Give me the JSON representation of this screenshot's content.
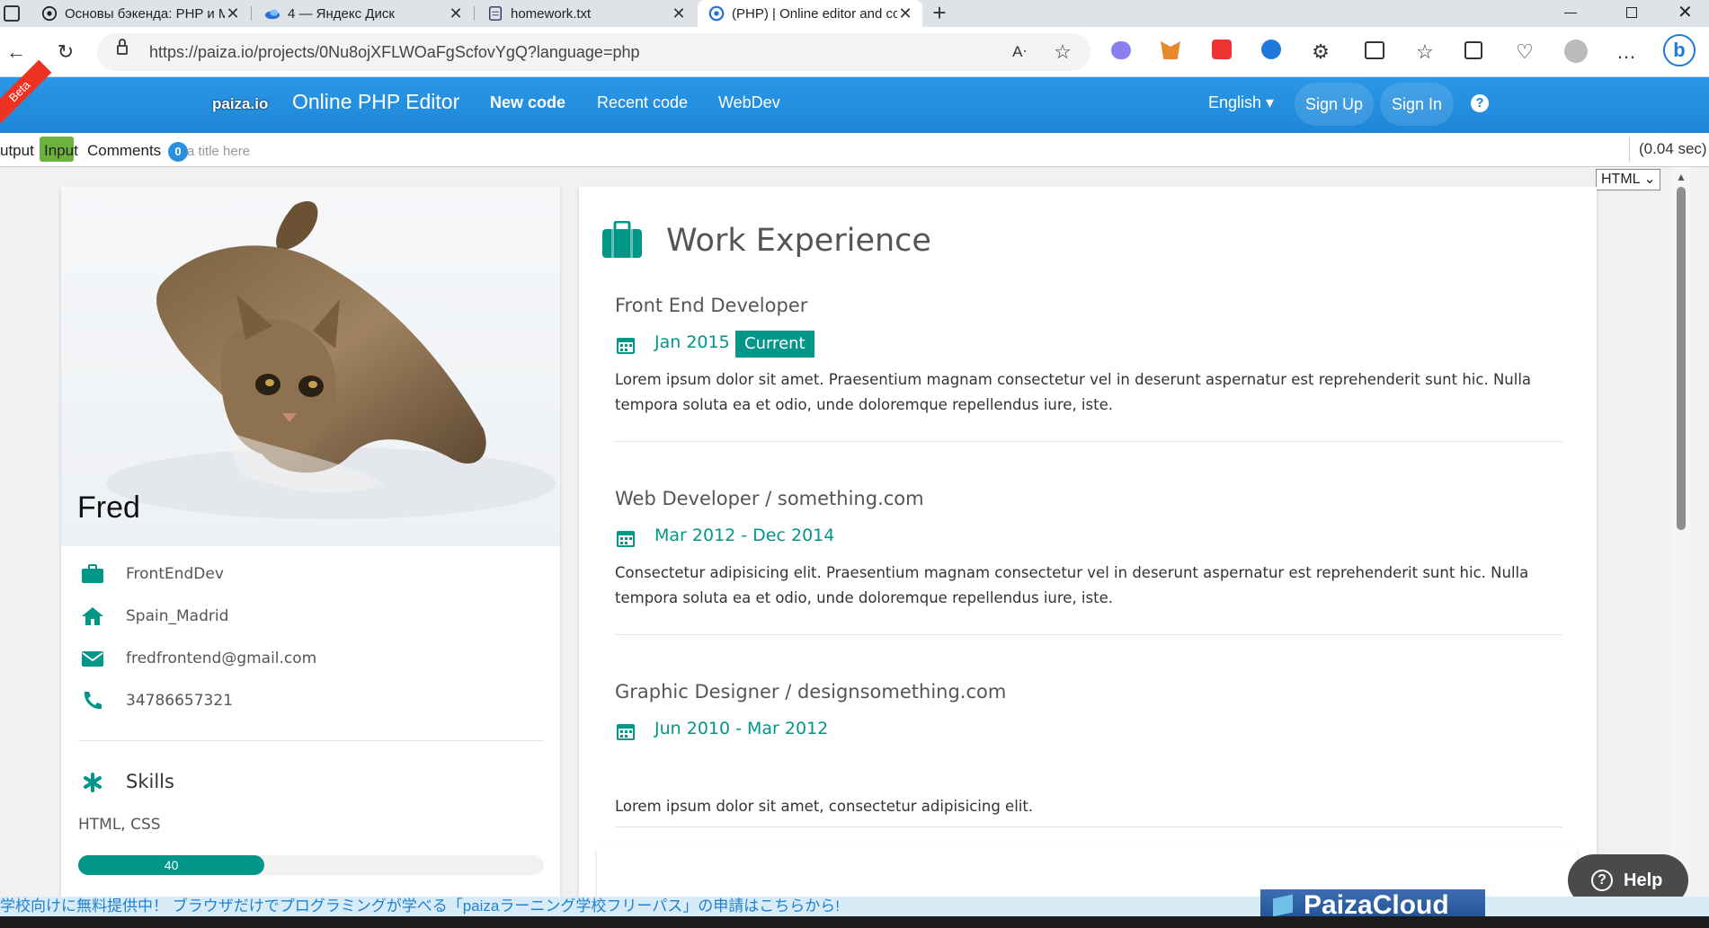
{
  "browser": {
    "tabs": [
      {
        "label": "Основы бэкенда: PHP и MySQL",
        "icon": "openai-icon"
      },
      {
        "label": "4 — Яндекс Диск",
        "icon": "yandex-disk-icon"
      },
      {
        "label": "homework.txt",
        "icon": "document-icon"
      },
      {
        "label": "(PHP) | Online editor and compiler",
        "icon": "paiza-icon"
      }
    ],
    "url": "https://paiza.io/projects/0Nu8ojXFLWOaFgScfovYgQ?language=php"
  },
  "paiza": {
    "ribbon": "Beta",
    "logo": "paiza.io",
    "editor_title": "Online PHP Editor",
    "nav": {
      "new_code": "New code",
      "recent_code": "Recent code",
      "webdev": "WebDev"
    },
    "language": "English",
    "sign_up": "Sign Up",
    "sign_in": "Sign In",
    "tabs": {
      "output": "utput",
      "input": "Input",
      "comments": "Comments",
      "comments_count": "0"
    },
    "title_placeholder": "Enter a title here",
    "exec_time": "(0.04 sec)",
    "view_select": "HTML"
  },
  "profile": {
    "name": "Fred",
    "job": "FrontEndDev",
    "location": "Spain_Madrid",
    "email": "fredfrontend@gmail.com",
    "phone": "34786657321",
    "skills_heading": "Skills",
    "skill_label": "HTML, CSS",
    "skill_value": "40",
    "skill_percent": 40
  },
  "work": {
    "heading": "Work Experience",
    "jobs": [
      {
        "title": "Front End Developer",
        "dates": "Jan 2015 - ",
        "badge": "Current",
        "desc": "Lorem ipsum dolor sit amet. Praesentium magnam consectetur vel in deserunt aspernatur est reprehenderit sunt hic. Nulla tempora soluta ea et odio, unde doloremque repellendus iure, iste."
      },
      {
        "title": "Web Developer / something.com",
        "dates": "Mar 2012 - Dec 2014",
        "badge": "",
        "desc": "Consectetur adipisicing elit. Praesentium magnam consectetur vel in deserunt aspernatur est reprehenderit sunt hic. Nulla tempora soluta ea et odio, unde doloremque repellendus iure, iste."
      },
      {
        "title": "Graphic Designer / designsomething.com",
        "dates": "Jun 2010 - Mar 2012",
        "badge": "",
        "desc": "Lorem ipsum dolor sit amet, consectetur adipisicing elit."
      }
    ]
  },
  "help_button": "Help",
  "promo_text": "学校向けに無料提供中！ ブラウザだけでプログラミングが学べる「paizaラーニング学校フリーパス」の申請はこちらから!",
  "paiza_cloud": "PaizaCloud",
  "colors": {
    "accent": "#009688",
    "paiza_blue": "#1e8ad8",
    "beta_red": "#e53935"
  }
}
